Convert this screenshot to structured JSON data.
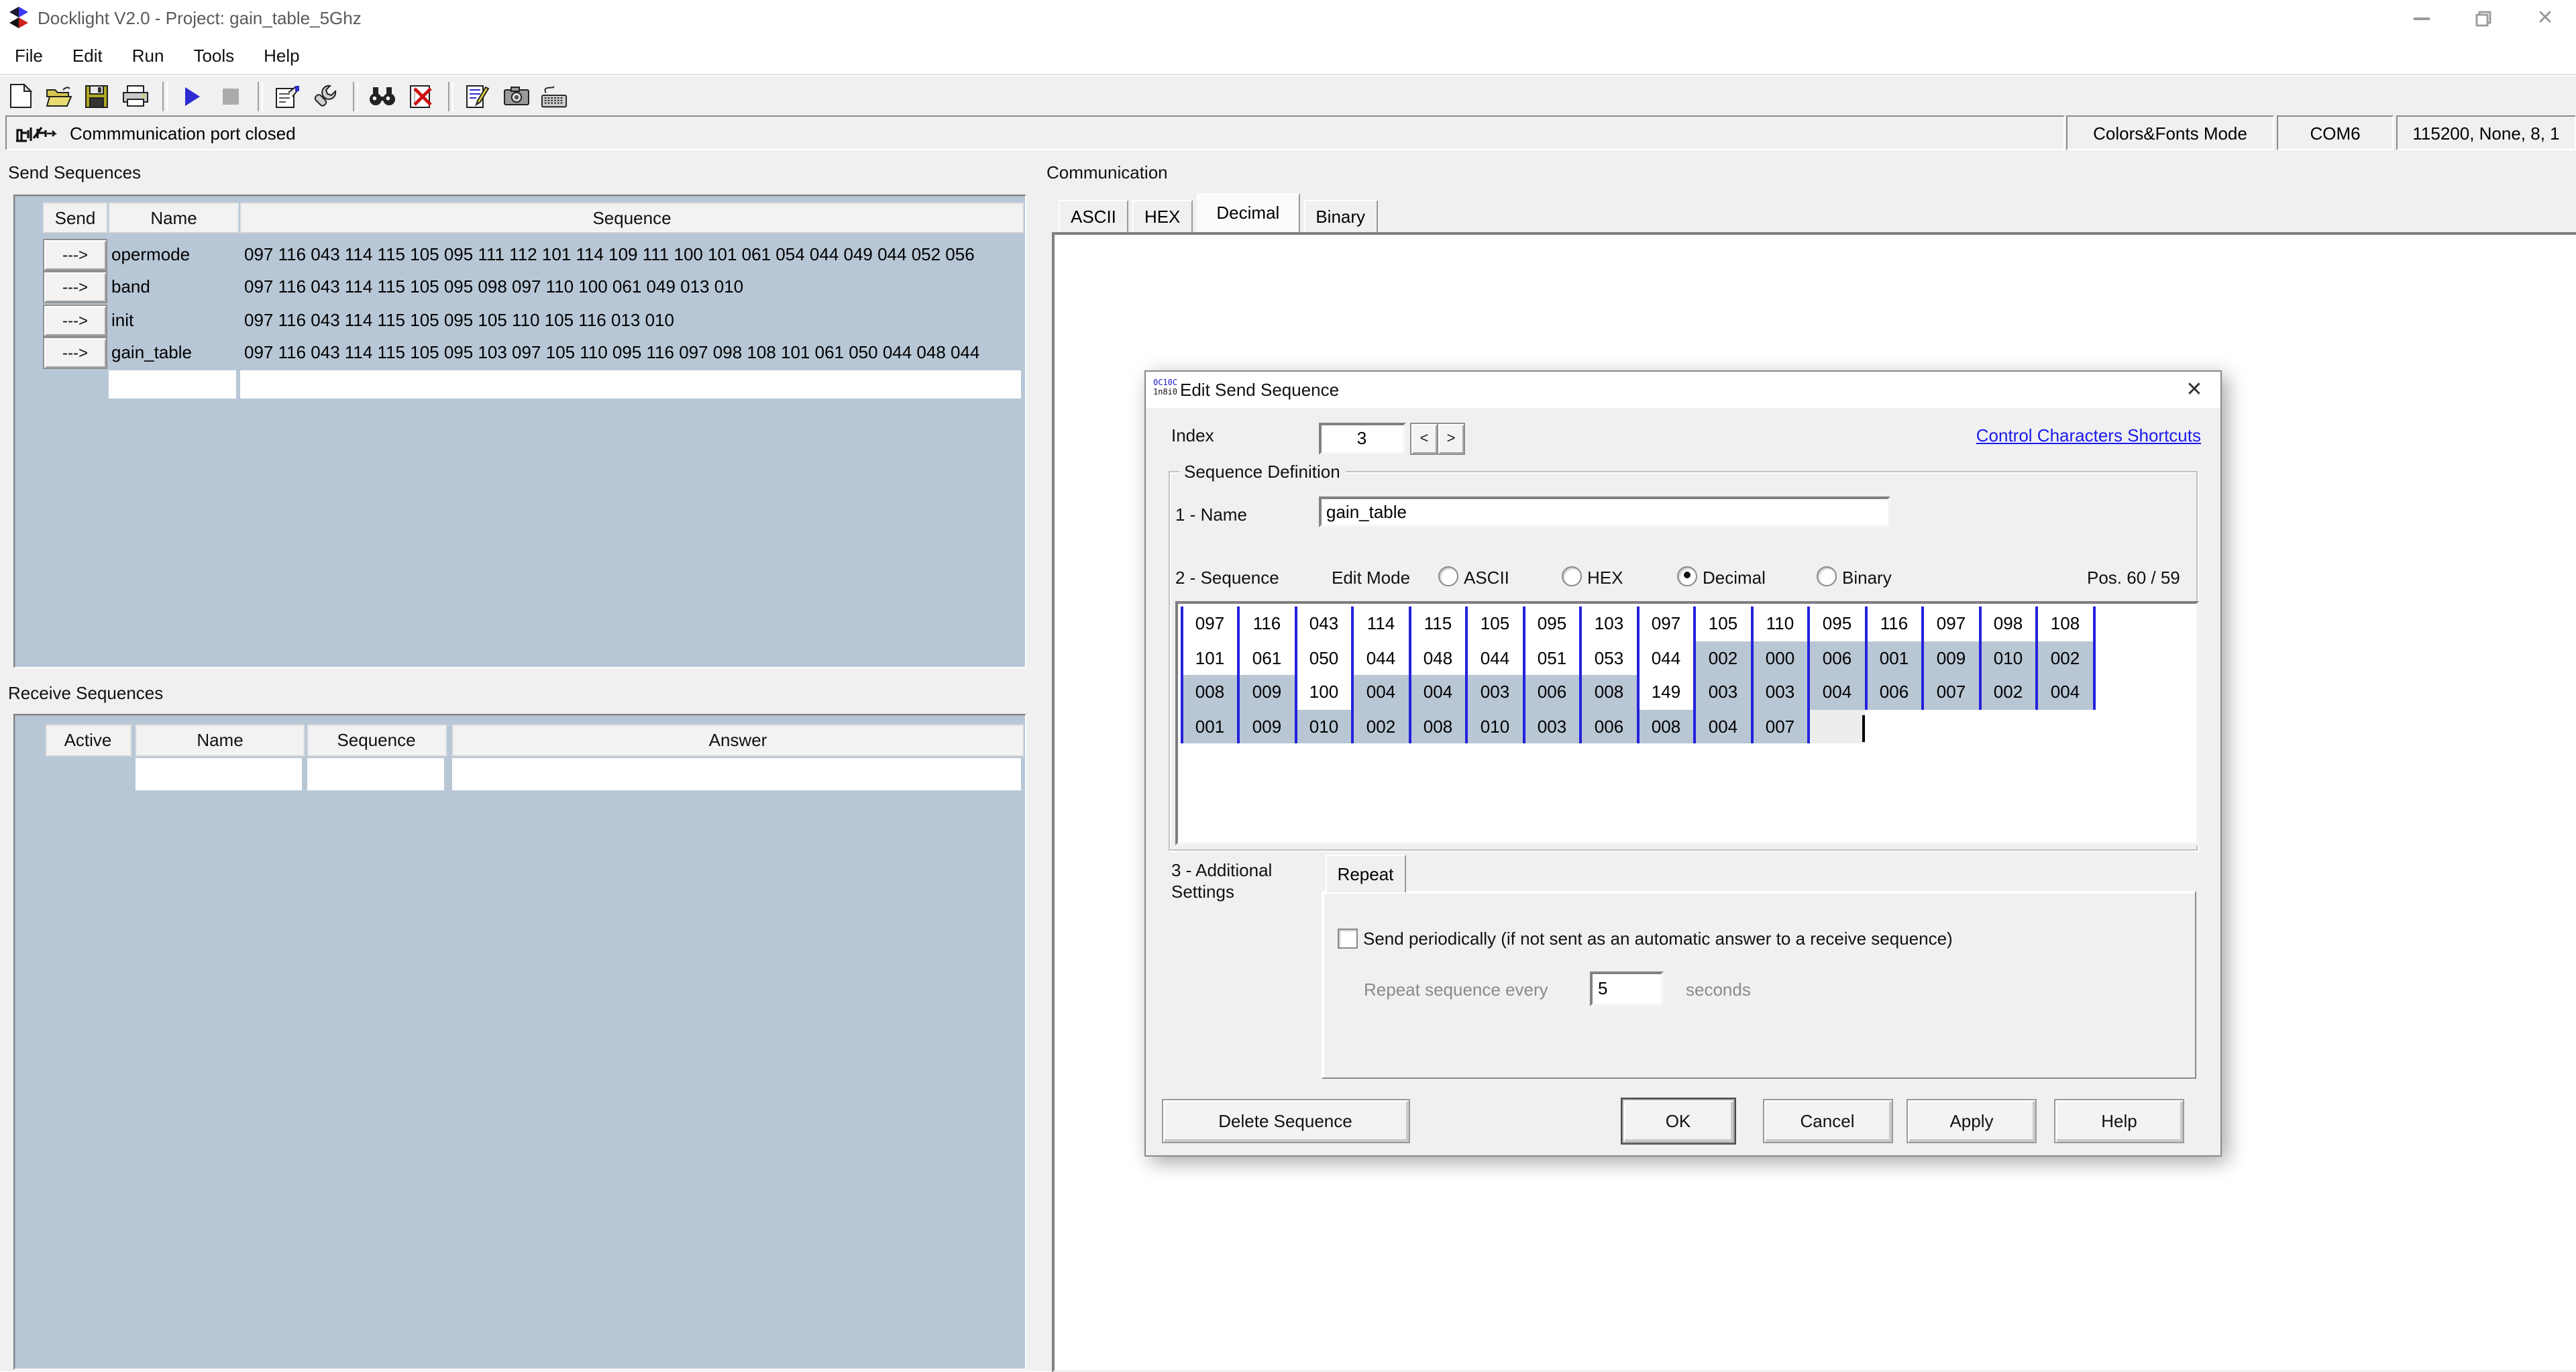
{
  "window": {
    "title": "Docklight V2.0 - Project: gain_table_5Ghz",
    "controls": [
      "minimize",
      "restore",
      "close"
    ]
  },
  "menu": {
    "items": [
      {
        "label": "File"
      },
      {
        "label": "Edit"
      },
      {
        "label": "Run"
      },
      {
        "label": "Tools"
      },
      {
        "label": "Help"
      }
    ]
  },
  "toolbar": {
    "icons": [
      "new-file",
      "open-project",
      "save-project",
      "print",
      "start-communication",
      "stop-communication",
      "project-settings",
      "options-wrench",
      "find",
      "clear-communication",
      "edit-notes",
      "snapshot",
      "keyboard-console"
    ]
  },
  "statusbar": {
    "message": "Commmunication port closed",
    "mode": "Colors&Fonts Mode",
    "port": "COM6",
    "params": "115200, None, 8, 1"
  },
  "send_sequences": {
    "title": "Send Sequences",
    "columns": [
      "Send",
      "Name",
      "Sequence"
    ],
    "send_button_label": "--->",
    "rows": [
      {
        "name": "opermode",
        "seq": "097 116 043 114 115 105 095 111 112 101 114 109 111 100 101 061 054 044 049 044 052 056"
      },
      {
        "name": "band",
        "seq": "097 116 043 114 115 105 095 098 097 110 100 061 049 013 010"
      },
      {
        "name": "init",
        "seq": "097 116 043 114 115 105 095 105 110 105 116 013 010"
      },
      {
        "name": "gain_table",
        "seq": "097 116 043 114 115 105 095 103 097 105 110 095 116 097 098 108 101 061 050 044 048 044"
      }
    ]
  },
  "receive_sequences": {
    "title": "Receive Sequences",
    "columns": [
      "Active",
      "Name",
      "Sequence",
      "Answer"
    ]
  },
  "communication": {
    "title": "Communication",
    "tabs": [
      {
        "label": "ASCII",
        "active": false
      },
      {
        "label": "HEX",
        "active": false
      },
      {
        "label": "Decimal",
        "active": true
      },
      {
        "label": "Binary",
        "active": false
      }
    ]
  },
  "dialog": {
    "title": "Edit Send Sequence",
    "index_label": "Index",
    "index_value": "3",
    "spin_prev": "<",
    "spin_next": ">",
    "link": "Control Characters Shortcuts",
    "group_title": "Sequence Definition",
    "name_label": "1 - Name",
    "name_value": "gain_table",
    "sequence_label": "2 - Sequence",
    "edit_mode_label": "Edit Mode",
    "edit_modes": [
      {
        "label": "ASCII",
        "selected": false
      },
      {
        "label": "HEX",
        "selected": false
      },
      {
        "label": "Decimal",
        "selected": true
      },
      {
        "label": "Binary",
        "selected": false
      }
    ],
    "pos_label": "Pos. 60 / 59",
    "grid": {
      "rows": [
        {
          "cells": [
            {
              "v": "097",
              "h": false
            },
            {
              "v": "116",
              "h": false
            },
            {
              "v": "043",
              "h": false
            },
            {
              "v": "114",
              "h": false
            },
            {
              "v": "115",
              "h": false
            },
            {
              "v": "105",
              "h": false
            },
            {
              "v": "095",
              "h": false
            },
            {
              "v": "103",
              "h": false
            },
            {
              "v": "097",
              "h": false
            },
            {
              "v": "105",
              "h": false
            },
            {
              "v": "110",
              "h": false
            },
            {
              "v": "095",
              "h": false
            },
            {
              "v": "116",
              "h": false
            },
            {
              "v": "097",
              "h": false
            },
            {
              "v": "098",
              "h": false
            },
            {
              "v": "108",
              "h": false
            }
          ]
        },
        {
          "cells": [
            {
              "v": "101",
              "h": false
            },
            {
              "v": "061",
              "h": false
            },
            {
              "v": "050",
              "h": false
            },
            {
              "v": "044",
              "h": false
            },
            {
              "v": "048",
              "h": false
            },
            {
              "v": "044",
              "h": false
            },
            {
              "v": "051",
              "h": false
            },
            {
              "v": "053",
              "h": false
            },
            {
              "v": "044",
              "h": false
            },
            {
              "v": "002",
              "h": true
            },
            {
              "v": "000",
              "h": true
            },
            {
              "v": "006",
              "h": true
            },
            {
              "v": "001",
              "h": true
            },
            {
              "v": "009",
              "h": true
            },
            {
              "v": "010",
              "h": true
            },
            {
              "v": "002",
              "h": true
            }
          ]
        },
        {
          "cells": [
            {
              "v": "008",
              "h": true
            },
            {
              "v": "009",
              "h": true
            },
            {
              "v": "100",
              "h": false
            },
            {
              "v": "004",
              "h": true
            },
            {
              "v": "004",
              "h": true
            },
            {
              "v": "003",
              "h": true
            },
            {
              "v": "006",
              "h": true
            },
            {
              "v": "008",
              "h": true
            },
            {
              "v": "149",
              "h": false
            },
            {
              "v": "003",
              "h": true
            },
            {
              "v": "003",
              "h": true
            },
            {
              "v": "004",
              "h": true
            },
            {
              "v": "006",
              "h": true
            },
            {
              "v": "007",
              "h": true
            },
            {
              "v": "002",
              "h": true
            },
            {
              "v": "004",
              "h": true
            }
          ]
        },
        {
          "cells": [
            {
              "v": "001",
              "h": true
            },
            {
              "v": "009",
              "h": true
            },
            {
              "v": "010",
              "h": true
            },
            {
              "v": "002",
              "h": true
            },
            {
              "v": "008",
              "h": true
            },
            {
              "v": "010",
              "h": true
            },
            {
              "v": "003",
              "h": true
            },
            {
              "v": "006",
              "h": true
            },
            {
              "v": "008",
              "h": true
            },
            {
              "v": "004",
              "h": true
            },
            {
              "v": "007",
              "h": true
            }
          ],
          "caret": true
        }
      ]
    },
    "additional_label_line1": "3 - Additional",
    "additional_label_line2": "Settings",
    "repeat_tab": "Repeat",
    "send_periodically_label": "Send periodically  (if not sent as an automatic answer to a receive sequence)",
    "repeat_every_label": "Repeat sequence every",
    "repeat_value": "5",
    "seconds_label": "seconds",
    "buttons": [
      "Delete Sequence",
      "OK",
      "Cancel",
      "Apply",
      "Help"
    ]
  }
}
